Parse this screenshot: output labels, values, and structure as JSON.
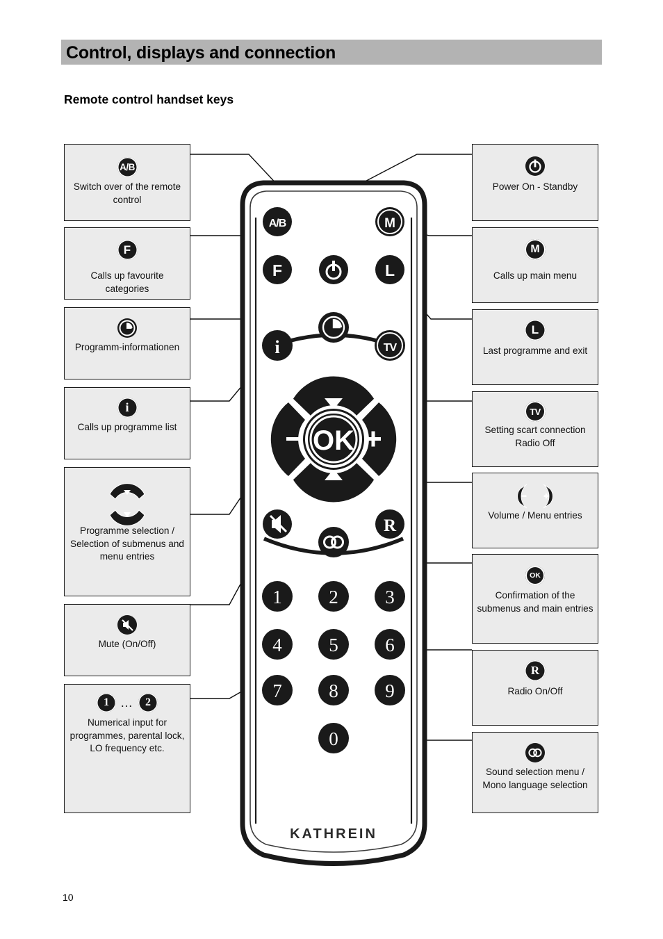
{
  "header": {
    "title": "Control, displays and connection",
    "subtitle": "Remote control handset keys",
    "page_number": "10",
    "bar_color": "#b3b3b3"
  },
  "remote": {
    "brand": "KATHREIN",
    "body_color": "#ffffff",
    "outline_color": "#1a1a1a",
    "key_color": "#1a1a1a",
    "keys": {
      "ab": "A/B",
      "m": "M",
      "f": "F",
      "power": "power-symbol",
      "l": "L",
      "clock": "clock-symbol",
      "info": "i",
      "tv": "TV",
      "up": "▲",
      "down": "▼",
      "minus": "−",
      "plus": "+",
      "ok": "OK",
      "mute": "mute-symbol",
      "sound": "sound-symbol",
      "radio": "R",
      "numbers": [
        "1",
        "2",
        "3",
        "4",
        "5",
        "6",
        "7",
        "8",
        "9",
        "0"
      ]
    }
  },
  "callouts": {
    "left": [
      {
        "id": "ab",
        "icon": "A/B",
        "text": "Switch over of the remote control"
      },
      {
        "id": "f",
        "icon": "F",
        "text": "Calls up favourite categories"
      },
      {
        "id": "clock",
        "icon": "clock-symbol",
        "text": "Programm-informationen"
      },
      {
        "id": "info",
        "icon": "i",
        "text": "Calls up programme list"
      },
      {
        "id": "updown",
        "icon": "up-down-rocker",
        "text": "Programme selection / Selection of submenus and menu entries"
      },
      {
        "id": "mute",
        "icon": "mute-symbol",
        "text": "Mute (On/Off)"
      },
      {
        "id": "numeric",
        "icon": "1 ... 2",
        "text": "Numerical input for programmes, parental lock, LO frequency etc."
      }
    ],
    "right": [
      {
        "id": "power",
        "icon": "power-symbol",
        "text": "Power On - Standby"
      },
      {
        "id": "m",
        "icon": "M",
        "text": "Calls up main menu"
      },
      {
        "id": "l",
        "icon": "L",
        "text": "Last programme and exit"
      },
      {
        "id": "tv",
        "icon": "TV",
        "text": "Setting scart connection Radio Off"
      },
      {
        "id": "volume",
        "icon": "minus-plus-rocker",
        "text": "Volume / Menu entries"
      },
      {
        "id": "ok",
        "icon": "OK",
        "text": "Confirmation of the submenus and main entries"
      },
      {
        "id": "radio",
        "icon": "R",
        "text": "Radio On/Off"
      },
      {
        "id": "sound",
        "icon": "sound-symbol",
        "text": "Sound selection menu / Mono language selection"
      }
    ]
  },
  "callout_lines": {
    "count": 15
  }
}
